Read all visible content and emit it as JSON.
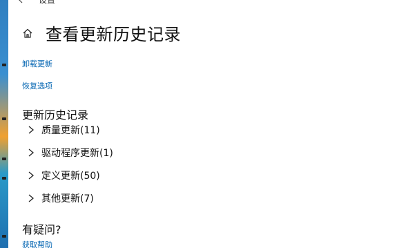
{
  "window": {
    "title": "设置"
  },
  "header": {
    "page_title": "查看更新历史记录"
  },
  "links": {
    "uninstall_updates": "卸载更新",
    "recovery_options": "恢复选项",
    "get_help": "获取帮助"
  },
  "history": {
    "section_title": "更新历史记录",
    "groups": [
      {
        "label": "质量更新(11)"
      },
      {
        "label": "驱动程序更新(1)"
      },
      {
        "label": "定义更新(50)"
      },
      {
        "label": "其他更新(7)"
      }
    ]
  },
  "help": {
    "section_title": "有疑问?"
  },
  "colors": {
    "link": "#0063b1",
    "text": "#111111",
    "background": "#ffffff"
  }
}
